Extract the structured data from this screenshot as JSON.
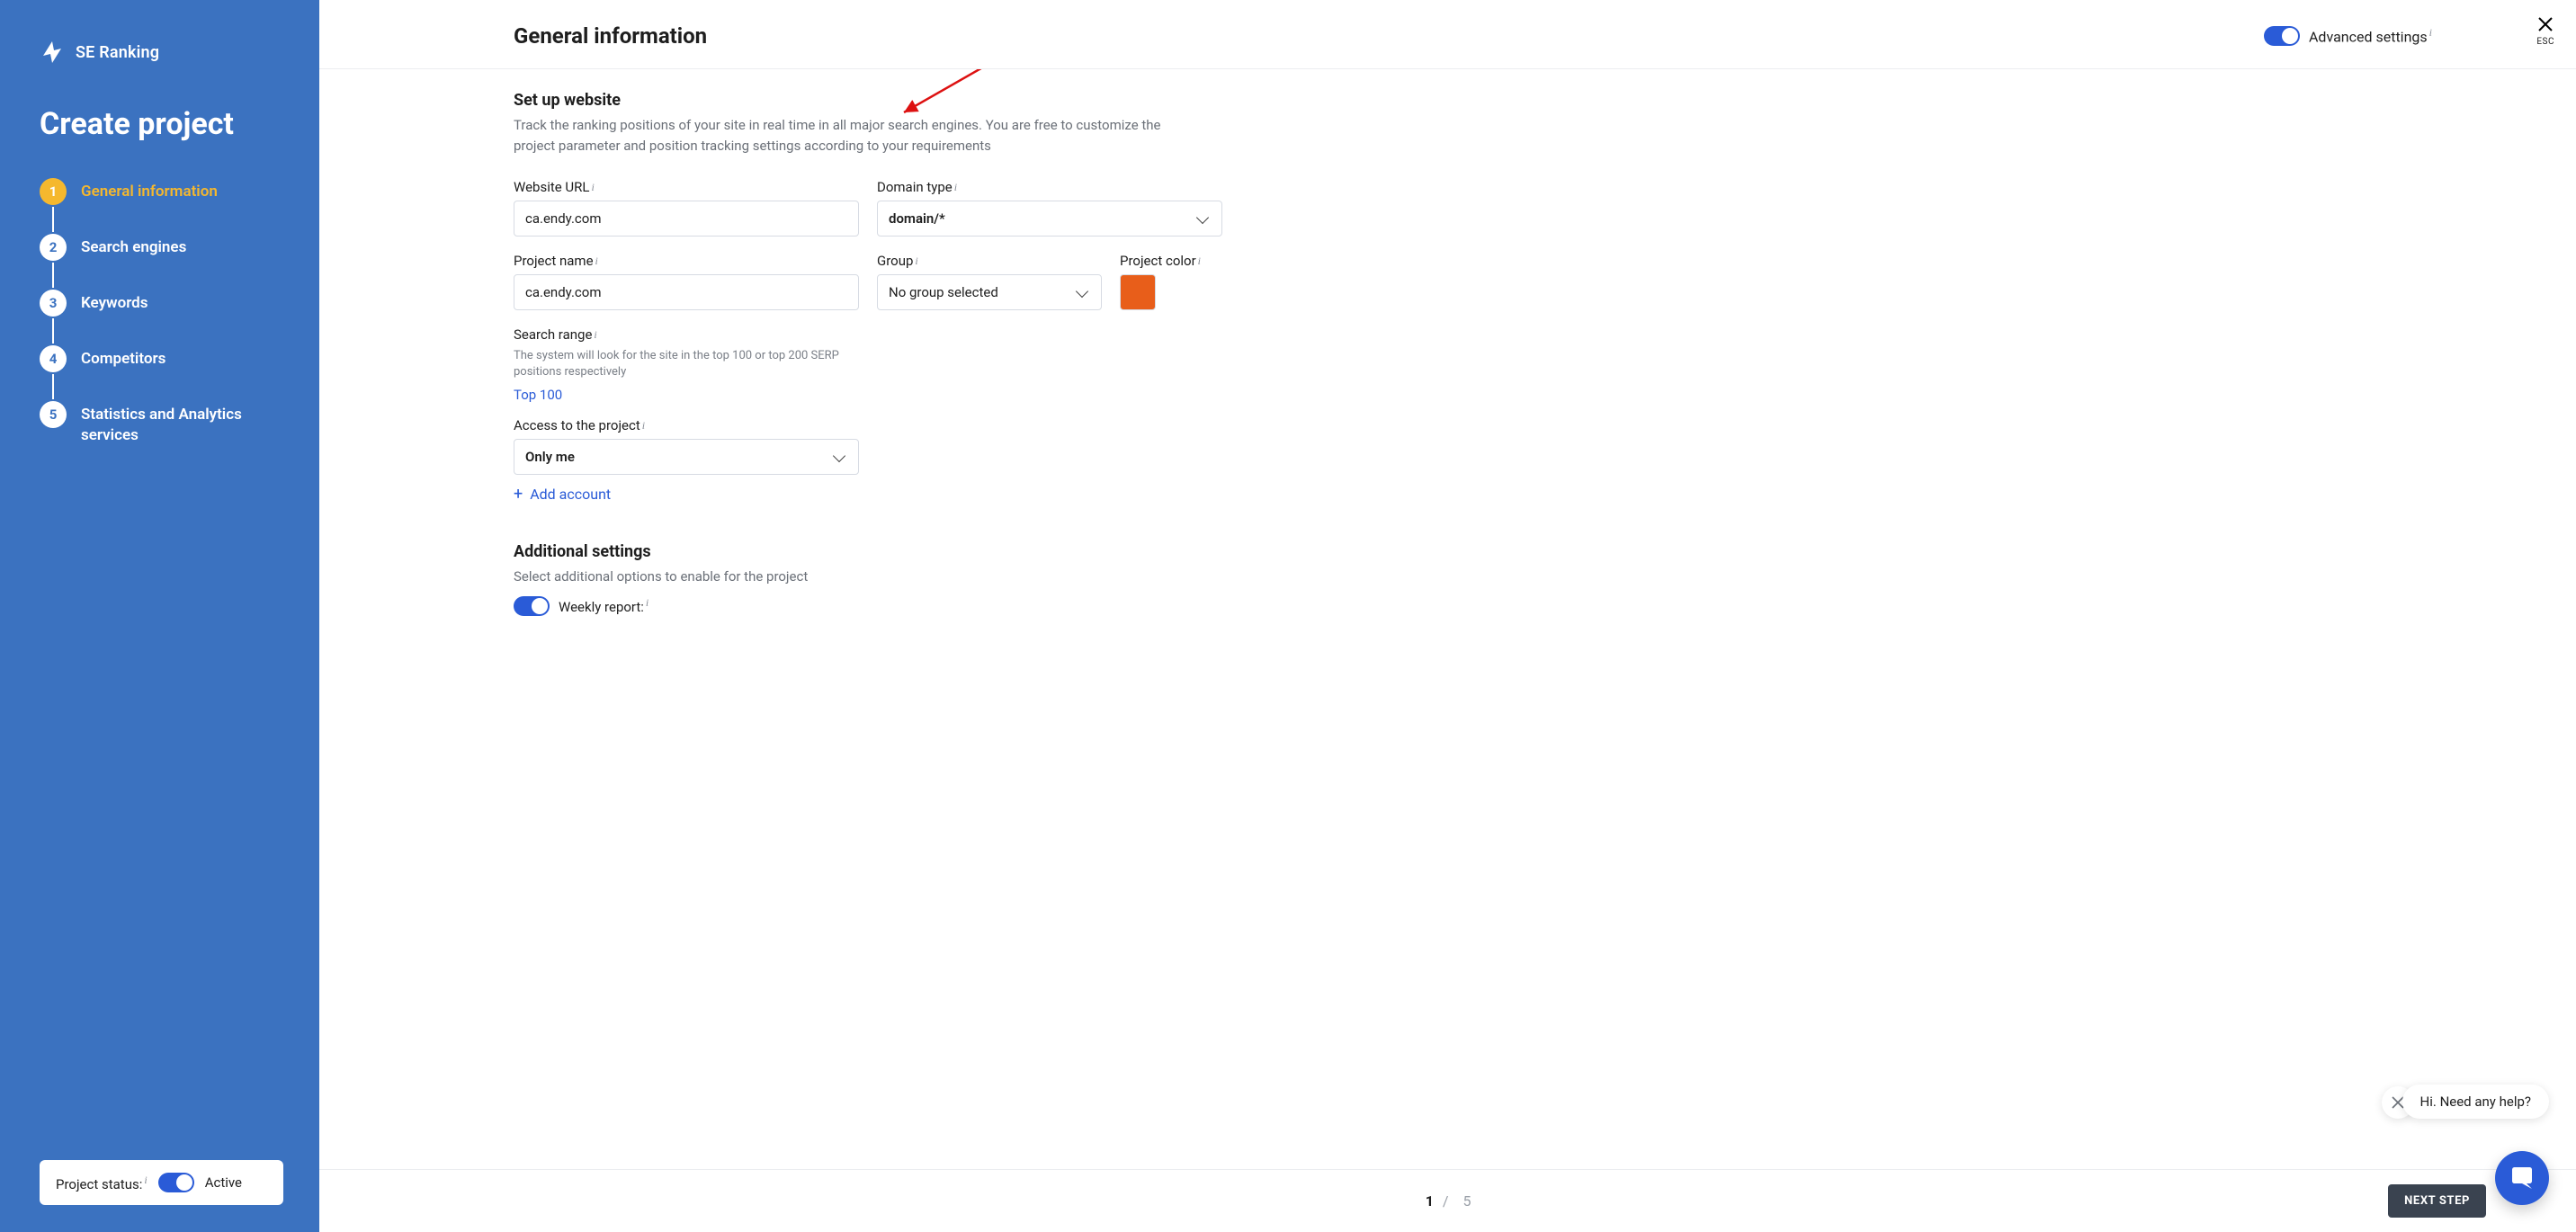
{
  "brand": {
    "name": "SE Ranking"
  },
  "sidebar": {
    "title": "Create project",
    "steps": [
      {
        "num": "1",
        "label": "General information",
        "active": true
      },
      {
        "num": "2",
        "label": "Search engines"
      },
      {
        "num": "3",
        "label": "Keywords"
      },
      {
        "num": "4",
        "label": "Competitors"
      },
      {
        "num": "5",
        "label": "Statistics and Analytics services"
      }
    ],
    "status": {
      "label": "Project status:",
      "value": "Active"
    }
  },
  "header": {
    "title": "General information",
    "advanced_label": "Advanced settings",
    "close_hint": "ESC"
  },
  "section_setup": {
    "title": "Set up website",
    "subtitle": "Track the ranking positions of your site in real time in all major search engines. You are free to customize the project parameter and position tracking settings according to your requirements",
    "website_url": {
      "label": "Website URL",
      "value": "ca.endy.com"
    },
    "domain_type": {
      "label": "Domain type",
      "value": "domain/*"
    },
    "project_name": {
      "label": "Project name",
      "value": "ca.endy.com"
    },
    "group": {
      "label": "Group",
      "value": "No group selected"
    },
    "project_color": {
      "label": "Project color",
      "value": "#e85e1a"
    },
    "search_range": {
      "label": "Search range",
      "note": "The system will look for the site in the top 100 or top 200 SERP positions respectively",
      "link": "Top 100"
    },
    "access": {
      "label": "Access to the project",
      "value": "Only me"
    },
    "add_account": "Add account"
  },
  "section_additional": {
    "title": "Additional settings",
    "subtitle": "Select additional options to enable for the project",
    "weekly_label": "Weekly report:"
  },
  "footer": {
    "page_current": "1",
    "page_sep": "/",
    "page_total": "5",
    "next": "NEXT STEP"
  },
  "chat": {
    "help_text": "Hi. Need any help?"
  }
}
